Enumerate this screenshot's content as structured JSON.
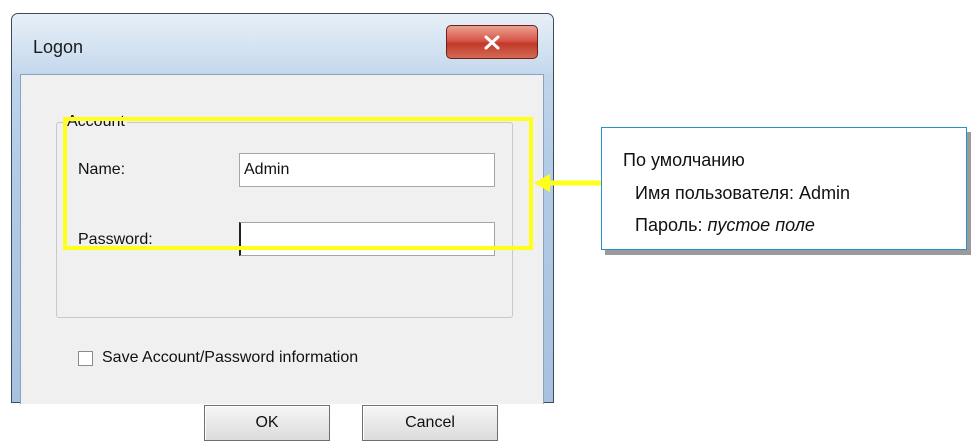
{
  "window": {
    "title": "Logon",
    "close_glyph": "✕"
  },
  "account": {
    "group_label": "Account",
    "name_label": "Name:",
    "name_value": "Admin",
    "password_label": "Password:",
    "password_value": ""
  },
  "save_info": {
    "label": "Save Account/Password information",
    "checked": false
  },
  "buttons": {
    "ok": "OK",
    "cancel": "Cancel"
  },
  "annotation": {
    "title": "По умолчанию",
    "username_line": "Имя пользователя: Admin",
    "password_prefix": "Пароль: ",
    "password_hint": "пустое поле",
    "highlight_color": "#ffff1a",
    "border_color": "#2a8fc8"
  },
  "icons": [
    "close-icon",
    "arrow-left-icon",
    "checkbox"
  ]
}
